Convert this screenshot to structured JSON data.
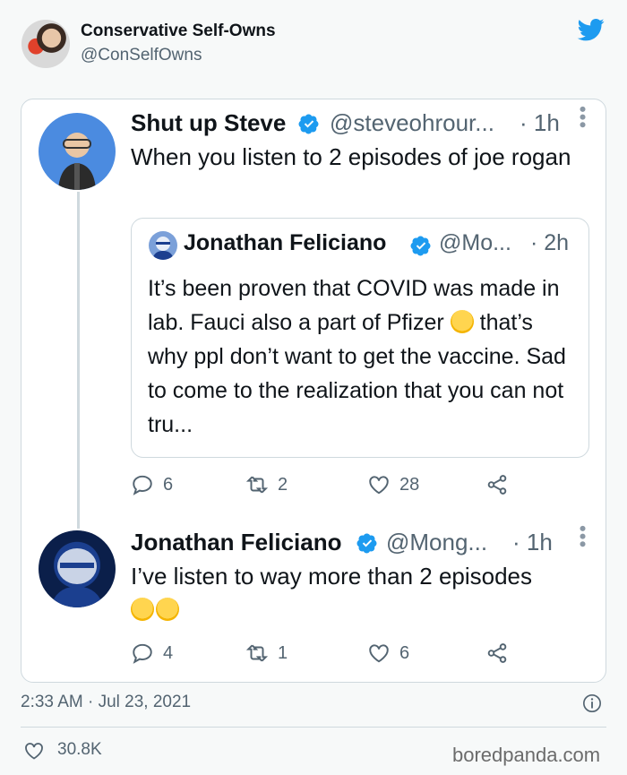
{
  "outer": {
    "name": "Conservative Self-Owns",
    "handle": "@ConSelfOwns"
  },
  "tweet1": {
    "name": "Shut up Steve",
    "handle": "@steveohrour...",
    "time": "· 1h",
    "text": "When you listen to 2 episodes of joe rogan",
    "actions": {
      "replies": "6",
      "retweets": "2",
      "likes": "28"
    }
  },
  "quote": {
    "name": "Jonathan Feliciano",
    "handle": "@Mo...",
    "time": "· 2h",
    "text_before_emoji": "It’s been proven that COVID was made in lab. Fauci also a part of Pfizer ",
    "text_after_emoji": " that’s why ppl don’t want to get the vaccine. Sad to come to the realization that you can not tru..."
  },
  "tweet2": {
    "name": "Jonathan Feliciano",
    "handle": "@Mong...",
    "time": "· 1h",
    "text": "I’ve listen to way more than 2 episodes",
    "actions": {
      "replies": "4",
      "retweets": "1",
      "likes": "6"
    }
  },
  "footer": {
    "timestamp": "2:33 AM · Jul 23, 2021",
    "like_count": "30.8K",
    "watermark": "boredpanda.com"
  },
  "colors": {
    "twitter_blue": "#1d9bf0",
    "text_secondary": "#536471",
    "border": "#cfd9de"
  },
  "icons": [
    "twitter-bird-icon",
    "verified-badge-icon",
    "reply-icon",
    "retweet-icon",
    "heart-icon",
    "share-icon",
    "info-icon",
    "more-dots-icon",
    "thinking-face-emoji",
    "laughing-crying-emoji"
  ]
}
